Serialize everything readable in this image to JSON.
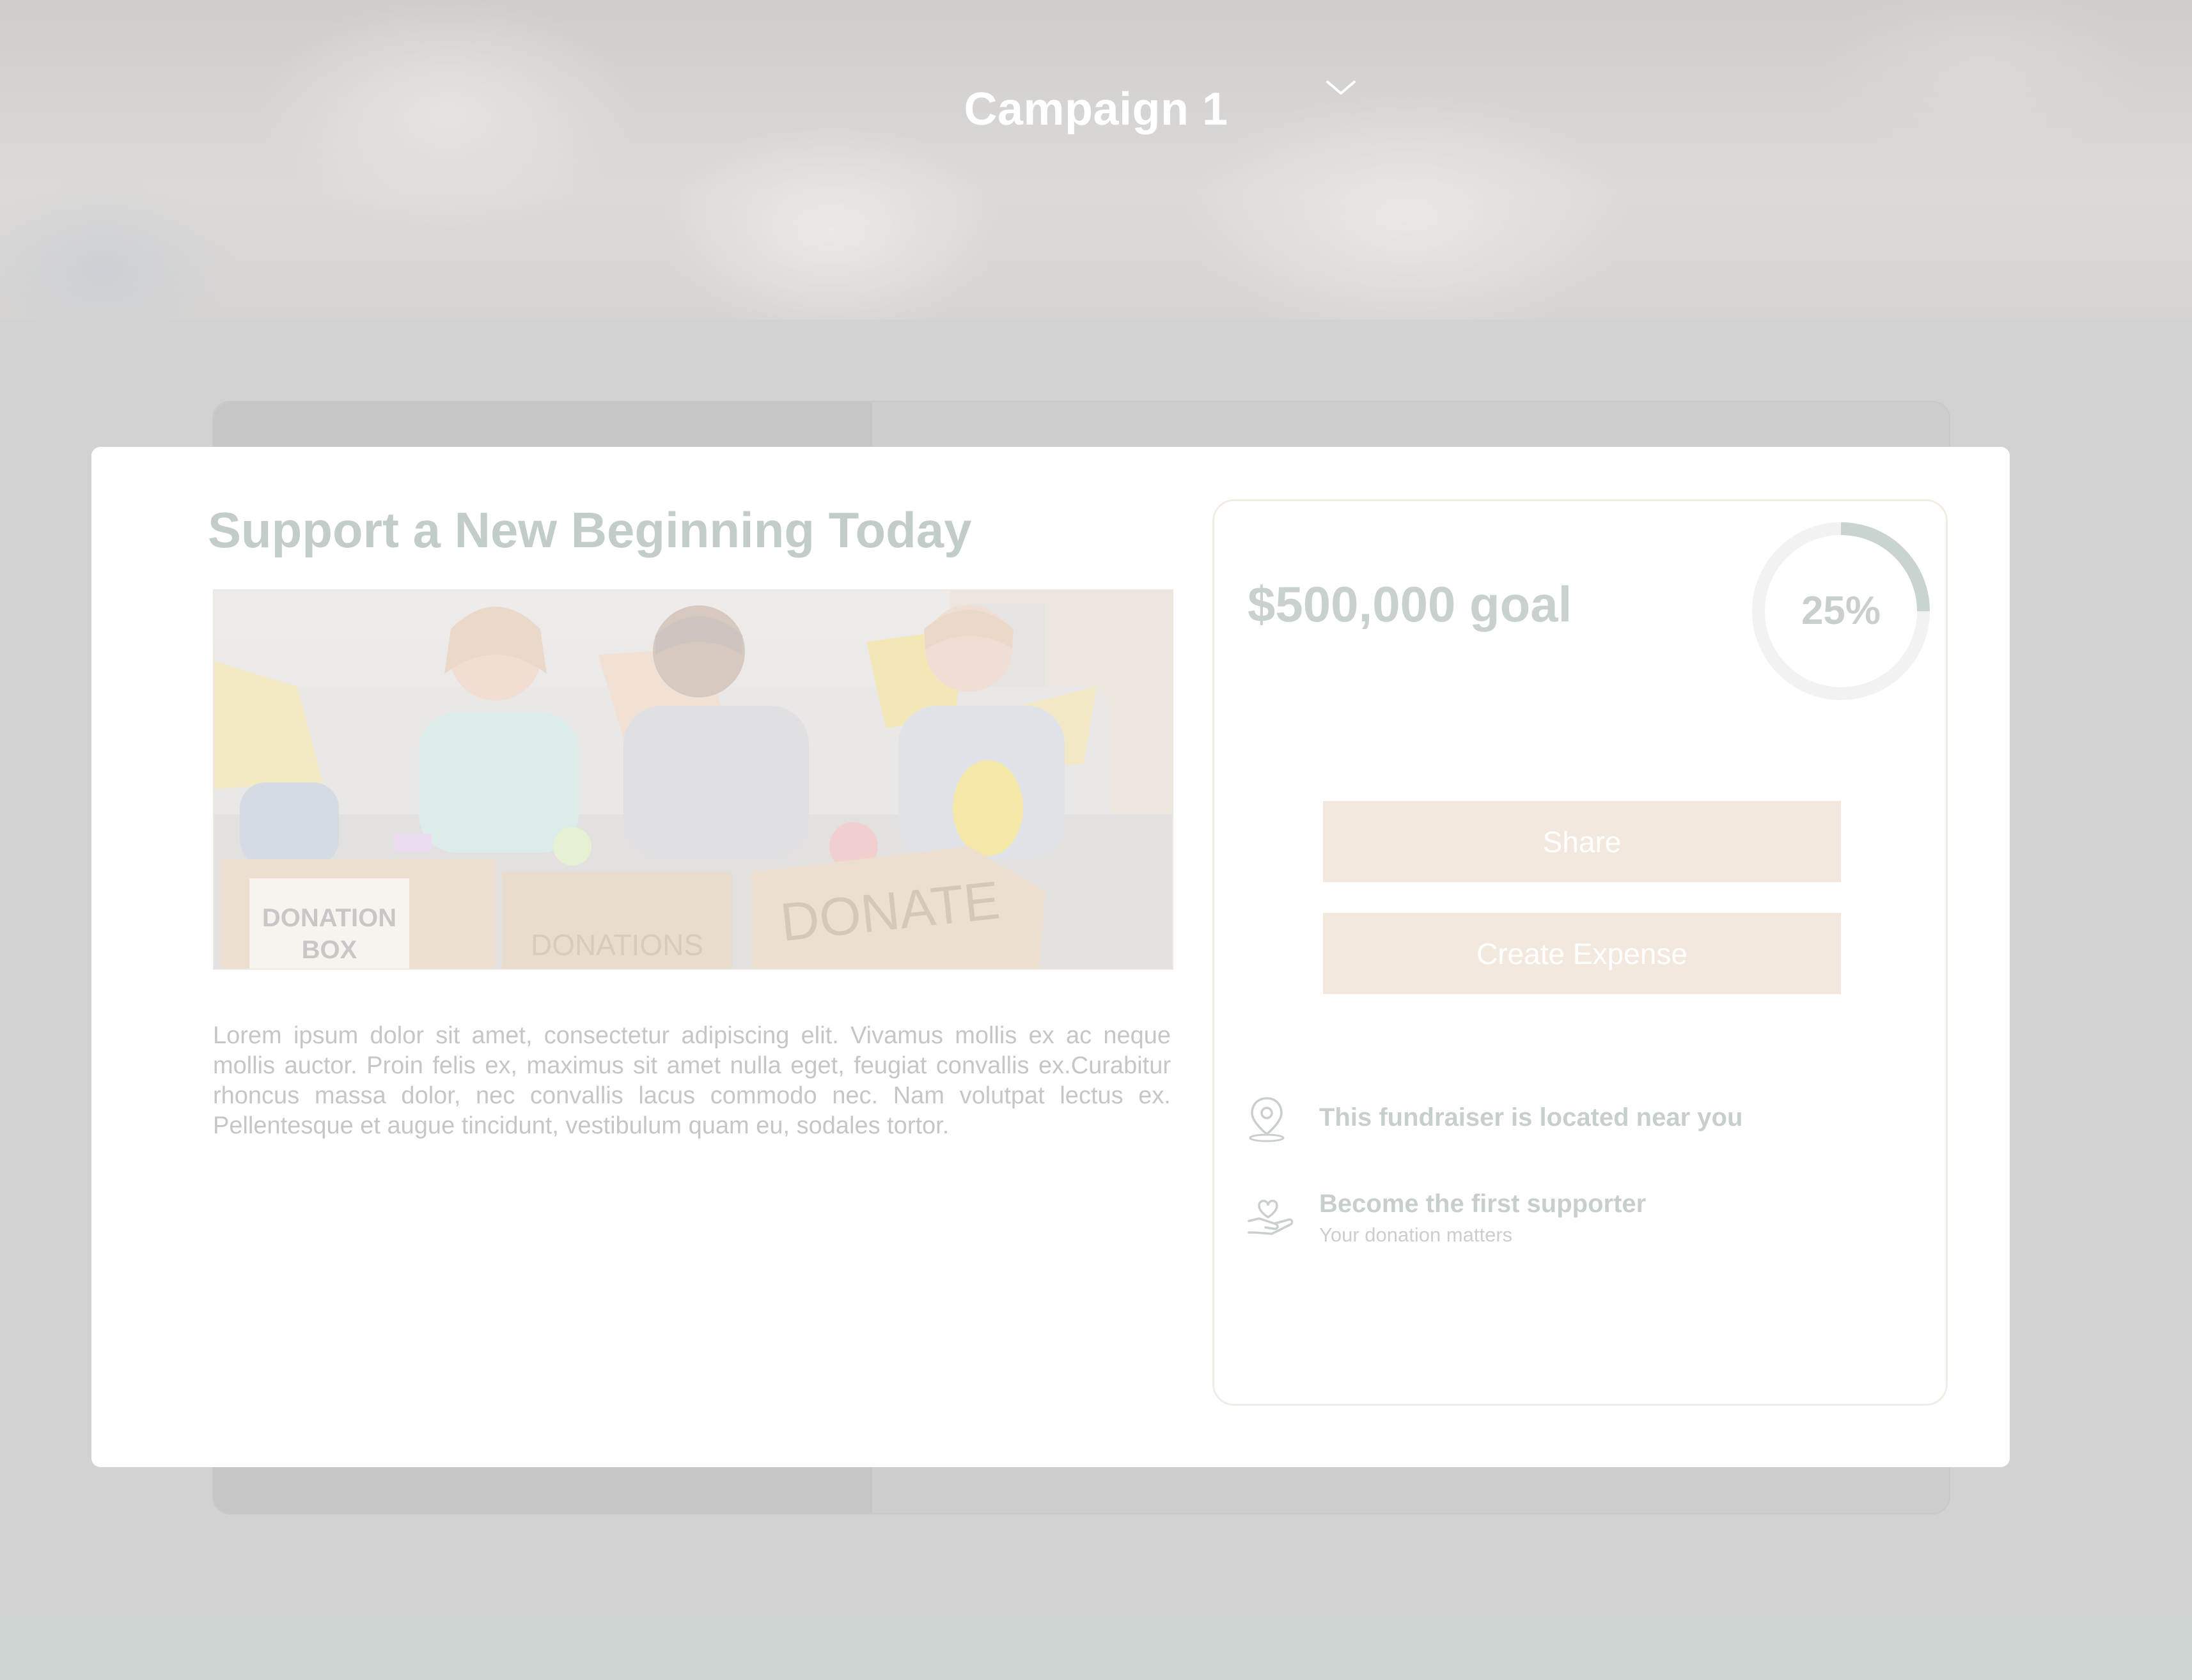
{
  "header": {
    "title": "Campaign 1"
  },
  "campaign": {
    "heading": "Support a New Beginning Today",
    "image_labels": {
      "box1": "DONATION BOX",
      "box2": "DONATIONS",
      "box3": "DONATE"
    },
    "description": "Lorem ipsum dolor sit amet, consectetur adipiscing elit. Vivamus mollis ex ac neque mollis auctor. Proin felis ex, maximus sit amet nulla eget, feugiat convallis ex.Curabitur rhoncus massa dolor, nec convallis lacus commodo nec. Nam volutpat lectus ex. Pellentesque et augue tincidunt, vestibulum quam eu, sodales tortor."
  },
  "panel": {
    "goal": "$500,000 goal",
    "progress_label": "25%",
    "progress_fraction": 0.25,
    "share_label": "Share",
    "expense_label": "Create Expense",
    "location_text": "This fundraiser is located near you",
    "supporter_title": "Become the first supporter",
    "supporter_subtitle": "Your donation matters"
  },
  "icons": {
    "chevron": "chevron-down-icon",
    "location": "location-pin-icon",
    "hand": "hand-heart-icon"
  },
  "colors": {
    "accent_button": "#f3e8dd",
    "muted_heading": "#c2ccc9",
    "overlay": "#d2d2d2",
    "ring_track": "#f2f2f2",
    "ring_fill": "#c9d3d0"
  }
}
